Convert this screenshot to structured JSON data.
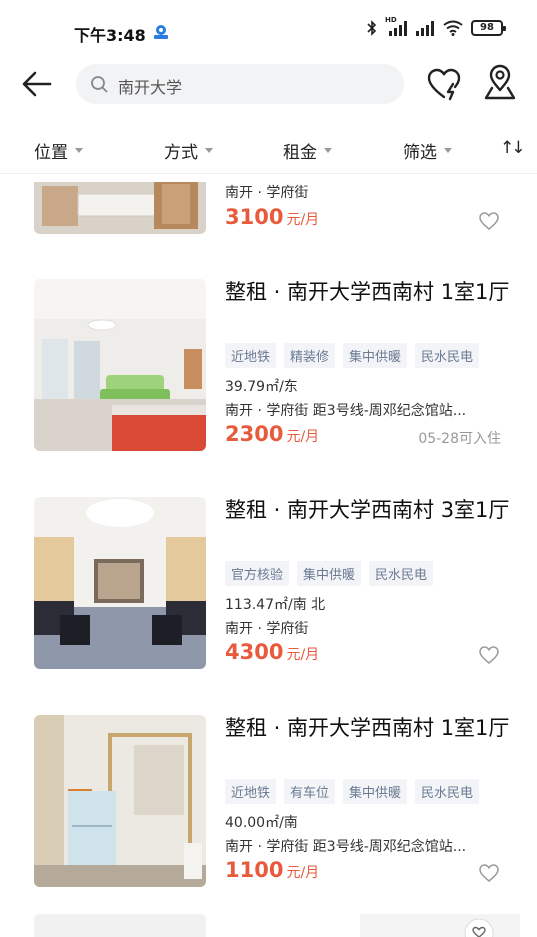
{
  "status_bar": {
    "time": "下午3:48",
    "hd_label": "HD",
    "battery": "98"
  },
  "header": {
    "search_text": "南开大学"
  },
  "filters": [
    {
      "label": "位置"
    },
    {
      "label": "方式"
    },
    {
      "label": "租金"
    },
    {
      "label": "筛选"
    }
  ],
  "sort_glyph": "↑↓",
  "listings": [
    {
      "location": "南开 · 学府街",
      "price": "3100",
      "price_unit": "元/月"
    },
    {
      "title": "整租 · 南开大学西南村 1室1厅",
      "tags": [
        "近地铁",
        "精装修",
        "集中供暖",
        "民水民电"
      ],
      "area": "39.79㎡/东",
      "location": "南开 · 学府街 距3号线-周邓纪念馆站...",
      "price": "2300",
      "price_unit": "元/月",
      "availability": "05-28可入住"
    },
    {
      "title": "整租 · 南开大学西南村 3室1厅",
      "tags": [
        "官方核验",
        "集中供暖",
        "民水民电"
      ],
      "area": "113.47㎡/南 北",
      "location": "南开 · 学府街",
      "price": "4300",
      "price_unit": "元/月"
    },
    {
      "title": "整租 · 南开大学西南村 1室1厅",
      "tags": [
        "近地铁",
        "有车位",
        "集中供暖",
        "民水民电"
      ],
      "area": "40.00㎡/南",
      "location": "南开 · 学府街 距3号线-周邓纪念馆站...",
      "price": "1100",
      "price_unit": "元/月"
    }
  ],
  "colors": {
    "price": "#e85a3c",
    "tag_text": "#6b7a92",
    "tag_bg": "#f2f4f8",
    "search_bg": "#f2f3f5"
  },
  "icons": [
    "back-arrow-icon",
    "search-icon",
    "favorite-heart-lightning-icon",
    "map-pin-icon",
    "heart-outline-icon",
    "sort-icon",
    "chevron-down-icon"
  ]
}
